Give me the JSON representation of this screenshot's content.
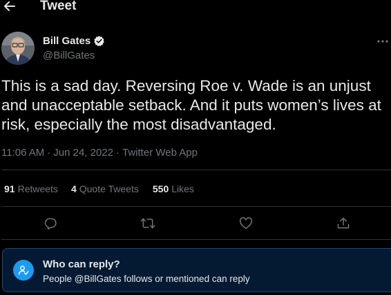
{
  "header": {
    "title": "Tweet"
  },
  "author": {
    "name": "Bill Gates",
    "handle": "@BillGates"
  },
  "tweet": {
    "text": "This is a sad day. Reversing Roe v. Wade is an unjust and unacceptable setback. And it puts women’s lives at risk, especially the most disadvantaged.",
    "time": "11:06 AM",
    "date": "Jun 24, 2022",
    "source": "Twitter Web App",
    "separator": "·"
  },
  "stats": {
    "retweets": {
      "count": "91",
      "label": "Retweets"
    },
    "quotes": {
      "count": "4",
      "label": "Quote Tweets"
    },
    "likes": {
      "count": "550",
      "label": "Likes"
    }
  },
  "reply_banner": {
    "title": "Who can reply?",
    "subtitle": "People @BillGates follows or mentioned can reply"
  },
  "icons": {
    "back": "back-arrow-icon",
    "verified": "verified-badge-icon",
    "more": "more-icon",
    "reply": "reply-icon",
    "retweet": "retweet-icon",
    "like": "like-icon",
    "share": "share-icon",
    "mention": "mention-user-icon"
  },
  "colors": {
    "background": "#000000",
    "text": "#e7e9ea",
    "secondary": "#71767b",
    "accent": "#1d9bf0",
    "divider": "#2f3336",
    "banner_bg": "#041a33"
  }
}
